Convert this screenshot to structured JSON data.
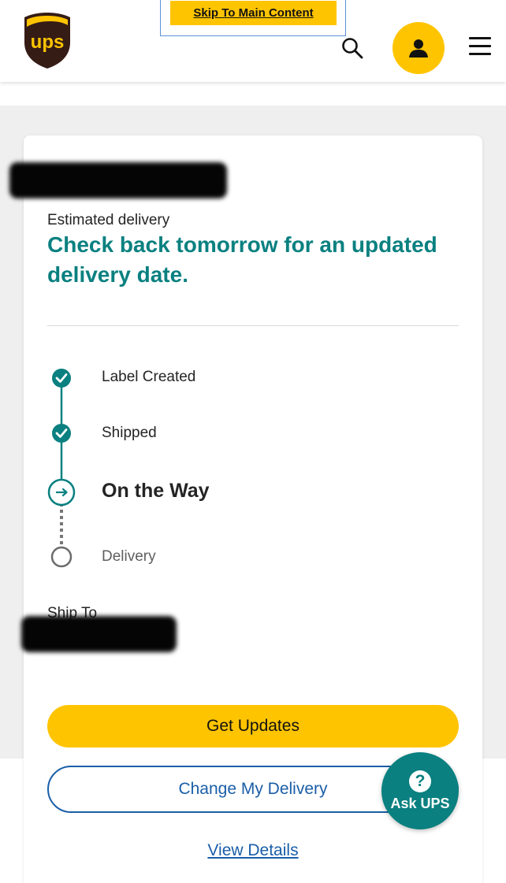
{
  "header": {
    "logo_text": "ups",
    "skip_link": "Skip To Main Content",
    "search_icon": "search-icon",
    "account_icon": "user-icon",
    "menu_icon": "hamburger-menu-icon"
  },
  "tracking": {
    "estimated_label": "Estimated delivery",
    "estimated_value": "Check back tomorrow for an updated delivery date.",
    "steps": [
      {
        "label": "Label Created",
        "status": "complete"
      },
      {
        "label": "Shipped",
        "status": "complete"
      },
      {
        "label": "On the Way",
        "status": "current"
      },
      {
        "label": "Delivery",
        "status": "pending"
      }
    ],
    "ship_to_label": "Ship To"
  },
  "actions": {
    "get_updates": "Get Updates",
    "change_delivery": "Change My Delivery",
    "view_details": "View Details"
  },
  "ask_ups": {
    "label": "Ask UPS",
    "icon_glyph": "?"
  },
  "colors": {
    "brand_brown": "#351c15",
    "brand_gold": "#ffc400",
    "teal": "#0a8080",
    "link_blue": "#1a5ea8"
  }
}
